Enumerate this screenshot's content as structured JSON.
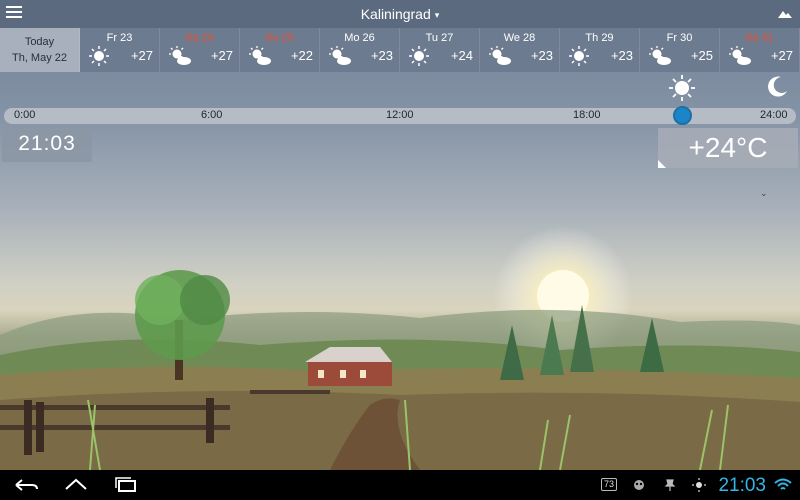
{
  "header": {
    "city": "Kaliningrad",
    "caret": "▾"
  },
  "forecast": {
    "today": {
      "name": "Today",
      "date": "Th, May 22"
    },
    "days": [
      {
        "name": "Fr 23",
        "temp": "+27",
        "icon": "sun-icon",
        "weekend": false
      },
      {
        "name": "Sa 24",
        "temp": "+27",
        "icon": "partly-cloudy-icon",
        "weekend": true
      },
      {
        "name": "Su 25",
        "temp": "+22",
        "icon": "partly-cloudy-icon",
        "weekend": true
      },
      {
        "name": "Mo 26",
        "temp": "+23",
        "icon": "partly-cloudy-icon",
        "weekend": false
      },
      {
        "name": "Tu 27",
        "temp": "+24",
        "icon": "sun-icon",
        "weekend": false
      },
      {
        "name": "We 28",
        "temp": "+23",
        "icon": "partly-cloudy-icon",
        "weekend": false
      },
      {
        "name": "Th 29",
        "temp": "+23",
        "icon": "sun-icon",
        "weekend": false
      },
      {
        "name": "Fr 30",
        "temp": "+25",
        "icon": "partly-cloudy-icon",
        "weekend": false
      },
      {
        "name": "Sa 31",
        "temp": "+27",
        "icon": "partly-cloudy-icon",
        "weekend": true
      }
    ]
  },
  "timeline": {
    "ticks": [
      "0:00",
      "6:00",
      "12:00",
      "18:00",
      "24:00"
    ],
    "position_hours": 21.05
  },
  "current": {
    "time": "21:03",
    "temperature": "+24°C"
  },
  "system": {
    "time": "21:03",
    "badge": "73"
  },
  "colors": {
    "accent": "#33b5e5",
    "weekend": "#e8502e",
    "slider": "#1a86c8"
  }
}
